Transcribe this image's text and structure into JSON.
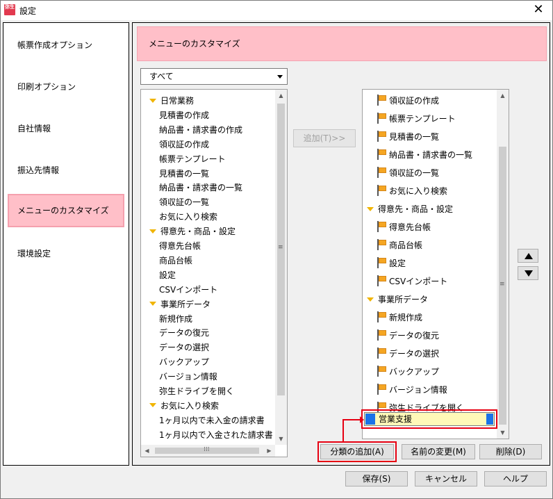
{
  "window": {
    "title": "設定",
    "app_icon_text": "弥生"
  },
  "sidebar": {
    "items": [
      {
        "label": "帳票作成オプション"
      },
      {
        "label": "印刷オプション"
      },
      {
        "label": "自社情報"
      },
      {
        "label": "振込先情報"
      },
      {
        "label": "メニューのカスタマイズ",
        "active": true
      },
      {
        "label": "環境設定"
      }
    ]
  },
  "header": {
    "title": "メニューのカスタマイズ"
  },
  "filter": {
    "selected": "すべて"
  },
  "left_tree": [
    {
      "label": "日常業務",
      "group": true
    },
    {
      "label": "見積書の作成"
    },
    {
      "label": "納品書・請求書の作成"
    },
    {
      "label": "領収証の作成"
    },
    {
      "label": "帳票テンプレート"
    },
    {
      "label": "見積書の一覧"
    },
    {
      "label": "納品書・請求書の一覧"
    },
    {
      "label": "領収証の一覧"
    },
    {
      "label": "お気に入り検索"
    },
    {
      "label": "得意先・商品・設定",
      "group": true
    },
    {
      "label": "得意先台帳"
    },
    {
      "label": "商品台帳"
    },
    {
      "label": "設定"
    },
    {
      "label": "CSVインポート"
    },
    {
      "label": "事業所データ",
      "group": true
    },
    {
      "label": "新規作成"
    },
    {
      "label": "データの復元"
    },
    {
      "label": "データの選択"
    },
    {
      "label": "バックアップ"
    },
    {
      "label": "バージョン情報"
    },
    {
      "label": "弥生ドライブを開く"
    },
    {
      "label": "お気に入り検索",
      "group": true
    },
    {
      "label": "1ヶ月以内で未入金の請求書"
    },
    {
      "label": "1ヶ月以内で入金された請求書"
    }
  ],
  "add_button": {
    "label": "追加(T)>>"
  },
  "right_tree": [
    {
      "label": "領収証の作成"
    },
    {
      "label": "帳票テンプレート"
    },
    {
      "label": "見積書の一覧"
    },
    {
      "label": "納品書・請求書の一覧"
    },
    {
      "label": "領収証の一覧"
    },
    {
      "label": "お気に入り検索"
    },
    {
      "label": "得意先・商品・設定",
      "group": true
    },
    {
      "label": "得意先台帳"
    },
    {
      "label": "商品台帳"
    },
    {
      "label": "設定"
    },
    {
      "label": "CSVインポート"
    },
    {
      "label": "事業所データ",
      "group": true
    },
    {
      "label": "新規作成"
    },
    {
      "label": "データの復元"
    },
    {
      "label": "データの選択"
    },
    {
      "label": "バックアップ"
    },
    {
      "label": "バージョン情報"
    },
    {
      "label": "弥生ドライブを開く"
    }
  ],
  "editing_item": {
    "value": "営業支援"
  },
  "buttons": {
    "add_category": "分類の追加(A)",
    "rename": "名前の変更(M)",
    "delete": "削除(D)",
    "save": "保存(S)",
    "cancel": "キャンセル",
    "help": "ヘルプ"
  },
  "colors": {
    "accent_pink": "#ffbfc8",
    "highlight_red": "#e60012",
    "flag_orange": "#f5a623",
    "edit_yellow": "#fff9b8"
  },
  "icons": {
    "up": "triangle-up-icon",
    "down": "triangle-down-icon",
    "flag": "flag-icon",
    "expand": "triangle-expand-icon"
  }
}
